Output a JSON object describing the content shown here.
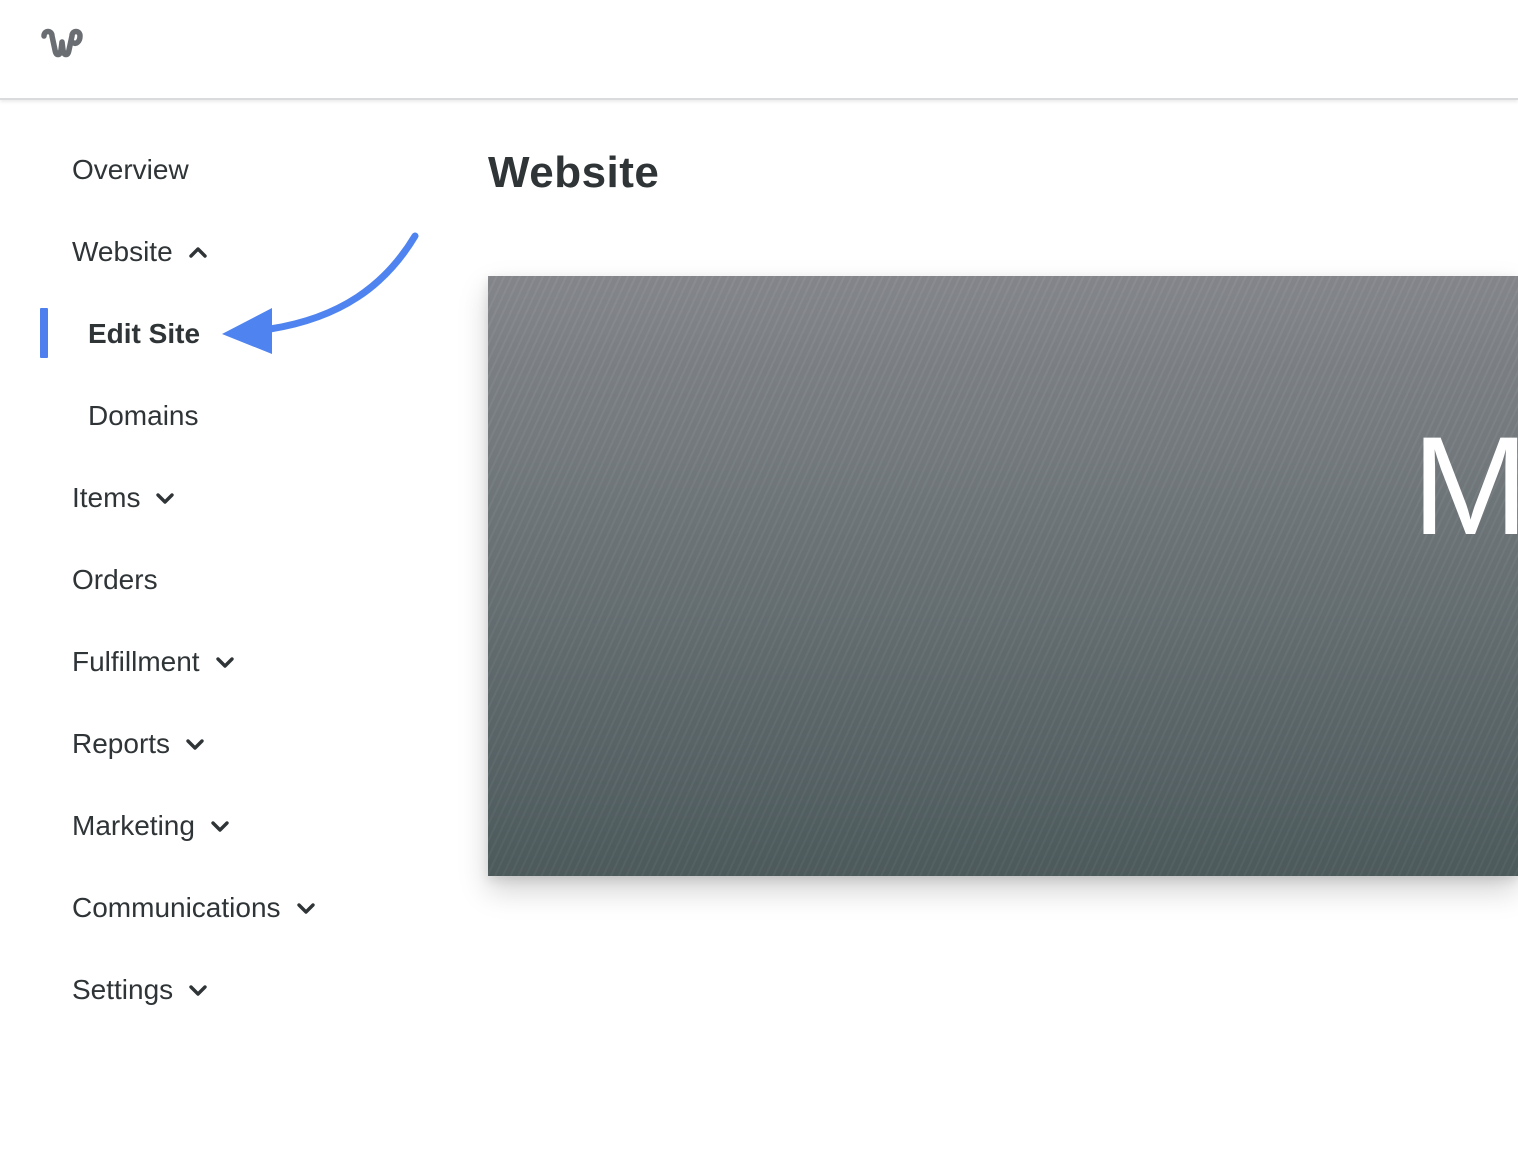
{
  "brand": {
    "logo_icon": "weebly-logo-icon"
  },
  "sidebar": {
    "items": [
      {
        "label": "Overview",
        "chevron": ""
      },
      {
        "label": "Website",
        "chevron": "up"
      },
      {
        "label": "Edit Site",
        "chevron": "",
        "active": true
      },
      {
        "label": "Domains",
        "chevron": ""
      },
      {
        "label": "Items",
        "chevron": "down"
      },
      {
        "label": "Orders",
        "chevron": ""
      },
      {
        "label": "Fulfillment",
        "chevron": "down"
      },
      {
        "label": "Reports",
        "chevron": "down"
      },
      {
        "label": "Marketing",
        "chevron": "down"
      },
      {
        "label": "Communications",
        "chevron": "down"
      },
      {
        "label": "Settings",
        "chevron": "down"
      }
    ],
    "active_color": "#4f7fee"
  },
  "main": {
    "title": "Website",
    "preview": {
      "headline": "M"
    }
  },
  "annotation": {
    "arrow_color": "#4f84f0",
    "arrow_target": "Edit Site"
  }
}
